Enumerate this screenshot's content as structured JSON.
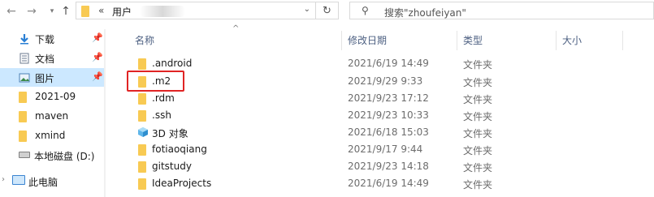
{
  "address": {
    "separator": "«",
    "path_segment": "用户",
    "search_placeholder": "搜索\"zhoufeiyan\""
  },
  "nav": {
    "items": [
      {
        "label": "下载",
        "pinned": true,
        "icon": "download-icon"
      },
      {
        "label": "文档",
        "pinned": true,
        "icon": "document-icon"
      },
      {
        "label": "图片",
        "pinned": true,
        "icon": "picture-icon",
        "selected": true
      },
      {
        "label": "2021-09",
        "icon": "folder-icon"
      },
      {
        "label": "maven",
        "icon": "folder-icon"
      },
      {
        "label": "xmind",
        "icon": "folder-icon"
      },
      {
        "label": "本地磁盘 (D:)",
        "icon": "drive-icon"
      },
      {
        "label": "此电脑",
        "icon": "computer-icon"
      }
    ]
  },
  "columns": {
    "name": "名称",
    "date": "修改日期",
    "type": "类型",
    "size": "大小"
  },
  "files": [
    {
      "name": ".android",
      "date": "2021/6/19 14:49",
      "type": "文件夹",
      "icon": "folder-icon"
    },
    {
      "name": ".m2",
      "date": "2021/9/29 9:33",
      "type": "文件夹",
      "icon": "folder-icon",
      "highlighted": true
    },
    {
      "name": ".rdm",
      "date": "2021/9/23 17:12",
      "type": "文件夹",
      "icon": "folder-icon"
    },
    {
      "name": ".ssh",
      "date": "2021/9/23 10:33",
      "type": "文件夹",
      "icon": "folder-icon"
    },
    {
      "name": "3D 对象",
      "date": "2021/6/18 15:03",
      "type": "文件夹",
      "icon": "3d-objects-icon"
    },
    {
      "name": "fotiaoqiang",
      "date": "2021/9/17 9:44",
      "type": "文件夹",
      "icon": "folder-icon"
    },
    {
      "name": "gitstudy",
      "date": "2021/9/23 14:18",
      "type": "文件夹",
      "icon": "folder-icon"
    },
    {
      "name": "IdeaProjects",
      "date": "2021/6/19 14:49",
      "type": "文件夹",
      "icon": "folder-icon"
    }
  ]
}
